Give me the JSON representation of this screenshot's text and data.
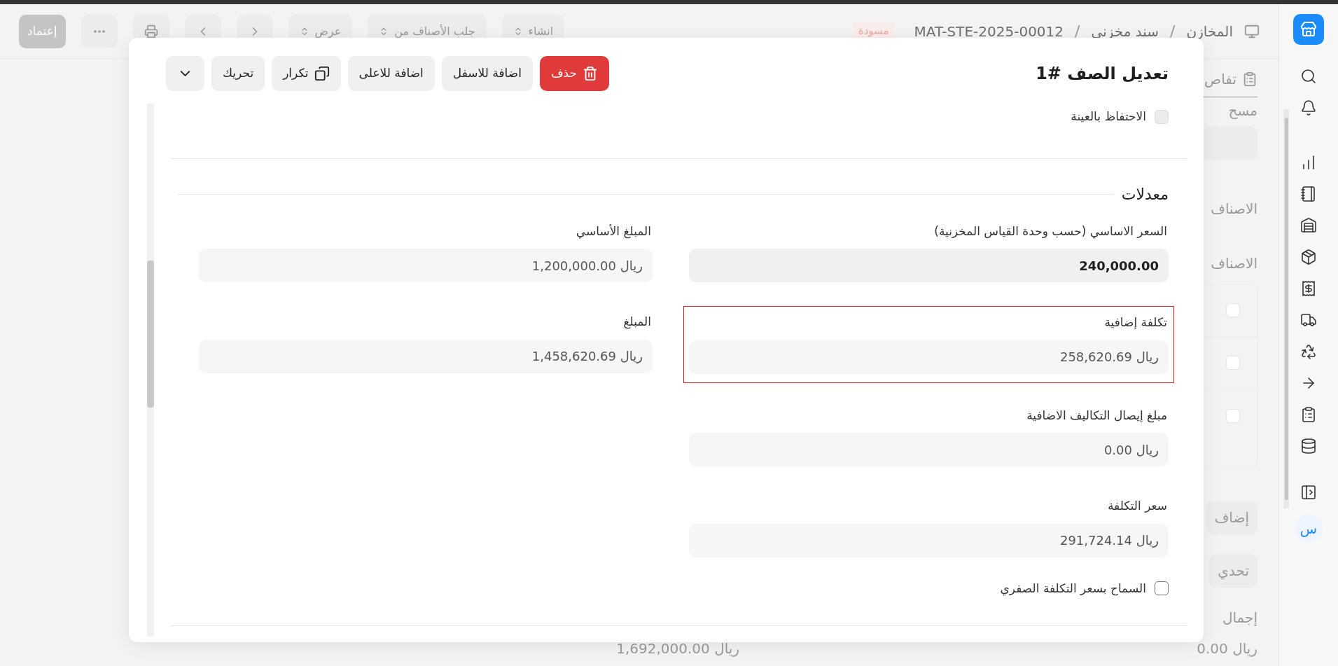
{
  "sidebar": {
    "avatar": "س"
  },
  "top_bar": {
    "breadcrumbs": [
      "المخازن",
      "سند مخزني",
      "MAT-STE-2025-00012"
    ],
    "separator": "/",
    "status_badge": "مسودة",
    "actions": [
      {
        "label": "انشاء",
        "kind": "select"
      },
      {
        "label": "جلب الأصناف من",
        "kind": "select"
      },
      {
        "label": "عرض",
        "kind": "select"
      },
      {
        "kind": "next"
      },
      {
        "kind": "previous"
      },
      {
        "kind": "print"
      },
      {
        "kind": "more"
      }
    ],
    "primary_button": {
      "label": "إعتماد",
      "disabled": true
    }
  },
  "background": {
    "tab": "تفاص",
    "field_label": "مسح",
    "section_labels": [
      "الاصناف",
      "الاصناف"
    ],
    "table_checkboxes": [
      {
        "checked": false
      },
      {
        "checked": false
      },
      {
        "checked": false
      }
    ],
    "buttons": [
      "إضاف",
      "تحدي"
    ],
    "total_label": "إجمال",
    "totals": [
      "ريال 0.00",
      "ريال 1,692,000.00"
    ]
  },
  "dialog": {
    "title": "تعديل الصف #1",
    "actions": [
      {
        "label": "حذف",
        "kind": "danger"
      },
      {
        "label": "اضافة للاسفل",
        "kind": "plain"
      },
      {
        "label": "اضافة للاعلى",
        "kind": "plain"
      },
      {
        "label": "تكرار",
        "kind": "copy"
      },
      {
        "label": "تحريك",
        "kind": "plain"
      },
      {
        "kind": "menu"
      }
    ],
    "retain_sample": {
      "label": "الاحتفاظ بالعينة",
      "checked": false,
      "disabled": true
    },
    "section_title": "معدلات",
    "right_fields": [
      {
        "label": "السعر الاساسي (حسب وحدة القياس المخزنية)",
        "value": "240,000.00",
        "kind": "editable",
        "highlighted": false
      },
      {
        "label": "تكلفة إضافية",
        "value": "ريال 258,620.69",
        "kind": "readonly",
        "highlighted": true
      },
      {
        "label": "مبلغ إيصال التكاليف الاضافية",
        "value": "ريال 0.00",
        "kind": "readonly",
        "highlighted": false
      },
      {
        "label": "سعر التكلفة",
        "value": "ريال 291,724.14",
        "kind": "readonly",
        "highlighted": false
      }
    ],
    "left_fields": [
      {
        "label": "المبلغ الأساسي",
        "value": "ريال 1,200,000.00",
        "kind": "readonly",
        "highlighted": false
      },
      {
        "label": "المبلغ",
        "value": "ريال 1,458,620.69",
        "kind": "readonly",
        "highlighted": false
      }
    ],
    "allow_zero_rate": {
      "label": "السماح بسعر التكلفة الصفري",
      "checked": false,
      "disabled": false
    }
  }
}
